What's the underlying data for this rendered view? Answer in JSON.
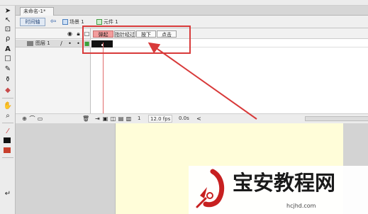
{
  "document": {
    "tab_label": "未命名-1*"
  },
  "edit_bar": {
    "timeline_button": "时间轴",
    "scene_label": "场景 1",
    "symbol_label": "元件 1"
  },
  "timeline": {
    "layer_name": "图层 1",
    "frame_labels": [
      "弹起",
      "指针经过",
      "按下",
      "点击"
    ],
    "current_frame": "1",
    "frame_rate": "12.0 fps",
    "elapsed_time": "0.0s"
  },
  "watermark": {
    "title": "宝安教程网",
    "url": "hcjhd.com"
  },
  "colors": {
    "annotation_red": "#d83a3a",
    "up_frame_highlight": "#f39d9d",
    "stage_fill": "#fffdd9"
  },
  "icons": [
    "arrow-tool-icon",
    "subselect-tool-icon",
    "free-transform-icon",
    "lasso-icon",
    "text-tool-icon",
    "rectangle-tool-icon",
    "pencil-icon",
    "ink-bottle-icon",
    "eraser-icon",
    "hand-tool-icon",
    "zoom-tool-icon",
    "stroke-color-icon",
    "fill-color-icon",
    "swap-colors-icon",
    "snap-icon",
    "back-arrow-icon",
    "eye-icon",
    "lock-icon",
    "outline-icon",
    "pencil-edit-icon",
    "add-layer-icon",
    "trash-icon",
    "onion-skin-icon"
  ]
}
